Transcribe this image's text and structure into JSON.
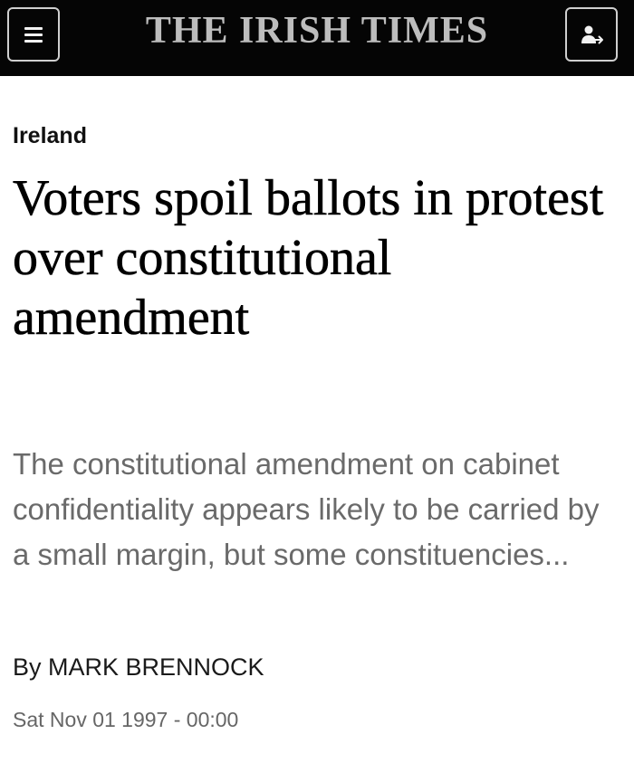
{
  "header": {
    "masthead": "THE IRISH TIMES",
    "menu_icon": "hamburger-menu-icon",
    "account_icon": "account-sign-in-icon",
    "background_color": "#050505",
    "masthead_color": "#bdbdbd"
  },
  "article": {
    "section": "Ireland",
    "headline": "Voters spoil ballots in protest over constitutional amendment",
    "standfirst": "The constitutional amendment on cabinet confidentiality appears likely to be carried by a small margin, but some constituencies...",
    "byline_prefix": "By",
    "author": "MARK BRENNOCK",
    "timestamp": "Sat Nov 01 1997 - 00:00"
  }
}
